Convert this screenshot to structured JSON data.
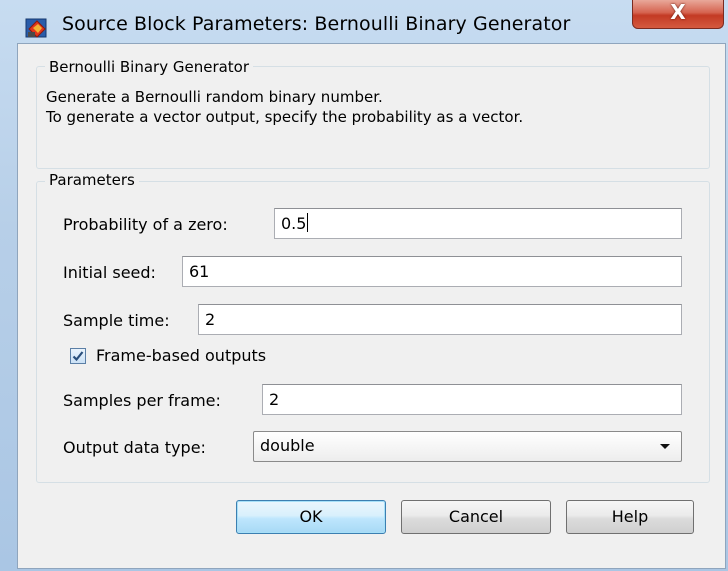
{
  "window": {
    "title": "Source Block Parameters: Bernoulli Binary Generator",
    "close_label": "X"
  },
  "description_group": {
    "legend": "Bernoulli Binary Generator",
    "lines": [
      "Generate a Bernoulli random binary number.",
      "To generate a vector output, specify the probability as a vector."
    ]
  },
  "parameters": {
    "legend": "Parameters",
    "probability": {
      "label": "Probability of a zero:",
      "value": "0.5"
    },
    "initial_seed": {
      "label": "Initial seed:",
      "value": "61"
    },
    "sample_time": {
      "label": "Sample time:",
      "value": "2"
    },
    "frame_based": {
      "label": "Frame-based outputs",
      "checked": true
    },
    "samples_per_frame": {
      "label": "Samples per frame:",
      "value": "2"
    },
    "output_data_type": {
      "label": "Output data type:",
      "value": "double"
    }
  },
  "buttons": {
    "ok": "OK",
    "cancel": "Cancel",
    "help": "Help"
  },
  "icons": {
    "app": "simulink-block-icon",
    "close": "close-icon",
    "check": "checkmark-icon",
    "dropdown": "chevron-down-icon"
  },
  "colors": {
    "title_gradient_top": "#c7dcf1",
    "client_background": "#f0f0f0",
    "close_button": "#c33a24",
    "default_button_border": "#3c7fb1"
  }
}
